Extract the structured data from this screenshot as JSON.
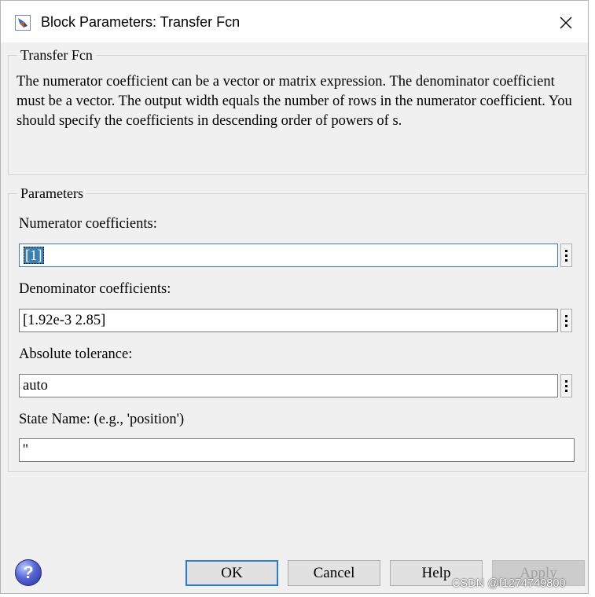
{
  "window": {
    "title": "Block Parameters: Transfer Fcn"
  },
  "block_group": {
    "legend": "Transfer Fcn",
    "description": "The numerator coefficient can be a vector or matrix expression. The denominator coefficient must be a vector. The output width equals the number of rows in the numerator coefficient. You should specify the coefficients in descending order of powers of s."
  },
  "params_group": {
    "legend": "Parameters",
    "numerator": {
      "label": "Numerator coefficients:",
      "value": "[1]"
    },
    "denominator": {
      "label": "Denominator coefficients:",
      "value": "[1.92e-3 2.85]"
    },
    "abs_tol": {
      "label": "Absolute tolerance:",
      "value": "auto"
    },
    "state_name": {
      "label": "State Name: (e.g., 'position')",
      "value": "''"
    }
  },
  "buttons": {
    "ok": "OK",
    "cancel": "Cancel",
    "help": "Help",
    "apply": "Apply"
  },
  "help_icon_glyph": "?",
  "watermark": "CSDN @f1274749800",
  "icons": {
    "title": "simulink-block-icon",
    "close": "close-icon",
    "help": "help-icon",
    "edit": "vertical-ellipsis-icon"
  },
  "colors": {
    "selection": "#3c7fb1",
    "default_button_border": "#2a7bd6",
    "dialog_bg": "#f0f0f0"
  }
}
